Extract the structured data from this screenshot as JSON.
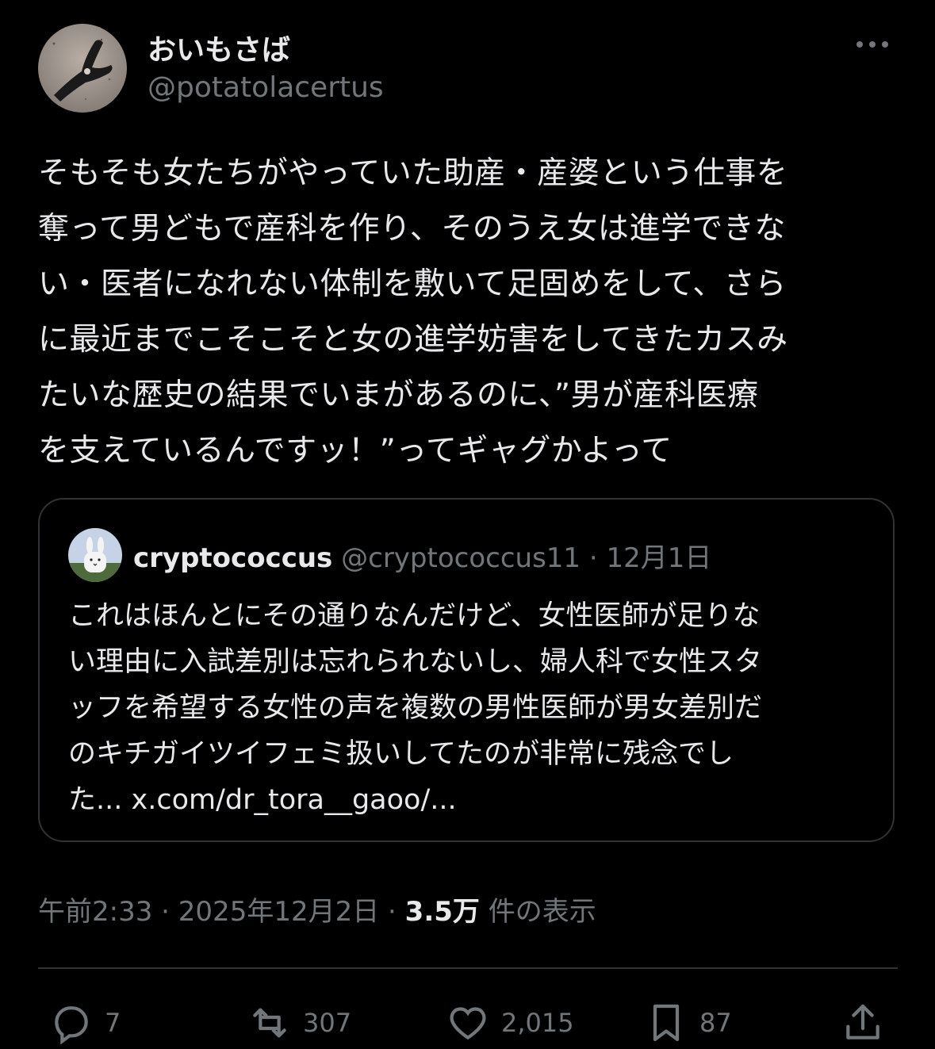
{
  "author": {
    "display_name": "おいもさば",
    "handle": "@potatolacertus",
    "avatar_icon": "lizard-avatar-icon"
  },
  "tweet": {
    "text": "そもそも女たちがやっていた助産・産婆という仕事を\n奪って男どもで産科を作り、そのうえ女は進学できな\nい・医者になれない体制を敷いて足固めをして、さら\nに最近までこそこそと女の進学妨害をしてきたカスみ\nたいな歴史の結果でいまがあるのに、”男が産科医療\nを支えているんですッ！”ってギャグかよって"
  },
  "quote": {
    "display_name": "cryptococcus",
    "handle": "@cryptococcus11",
    "separator": "·",
    "date": "12月1日",
    "avatar_icon": "rabbit-avatar-icon",
    "text": "これはほんとにその通りなんだけど、女性医師が足りな\nい理由に入試差別は忘れられないし、婦人科で女性スタ\nッフを希望する女性の声を複数の男性医師が男女差別だ\nのキチガイツイフェミ扱いしてたのが非常に残念でし\nた... x.com/dr_tora__gaoo/..."
  },
  "meta": {
    "time": "午前2:33",
    "separator": "·",
    "date": "2025年12月2日",
    "views_count": "3.5万",
    "views_label": "件の表示"
  },
  "actions": {
    "reply_count": "7",
    "retweet_count": "307",
    "like_count": "2,015",
    "bookmark_count": "87"
  },
  "colors": {
    "background": "#000000",
    "text_primary": "#e7e9ea",
    "text_secondary": "#71767b",
    "border": "#2f3336"
  }
}
